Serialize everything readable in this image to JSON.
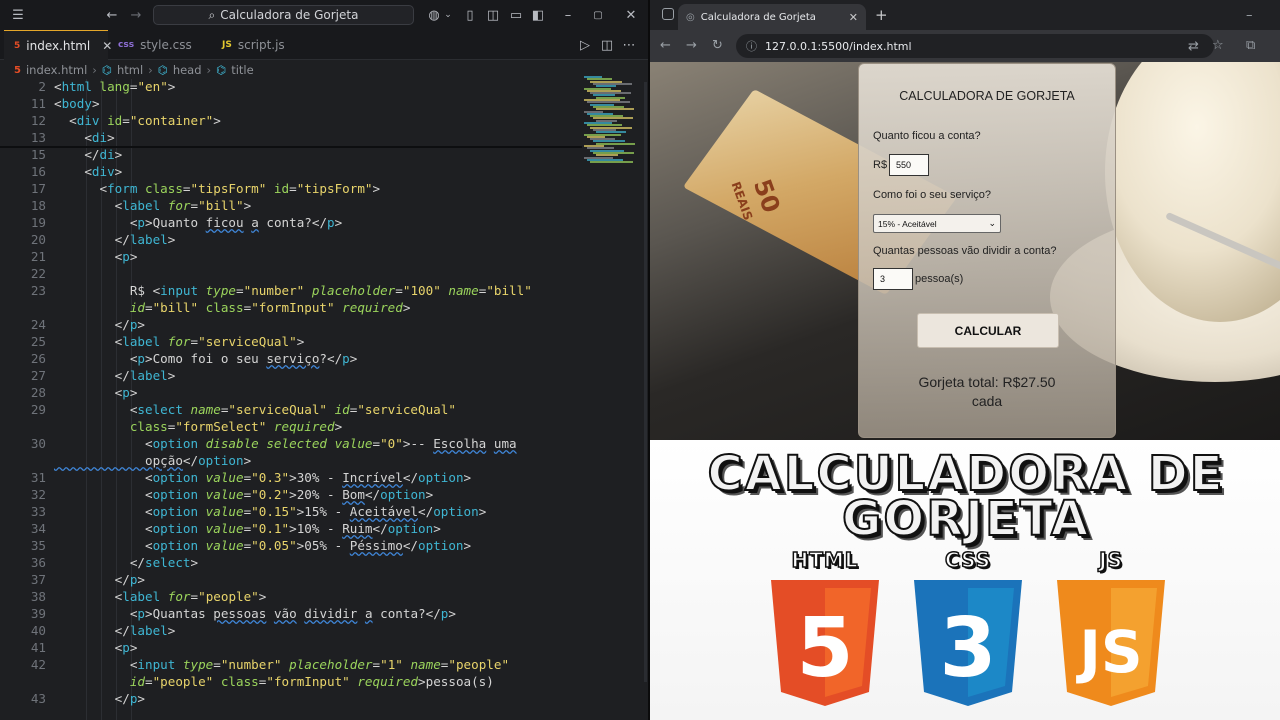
{
  "editor": {
    "search_title": "Calculadora de Gorjeta",
    "tabs": [
      {
        "badge": "5",
        "label": "index.html",
        "active": true
      },
      {
        "badge": "css",
        "label": "style.css",
        "active": false
      },
      {
        "badge": "JS",
        "label": "script.js",
        "active": false
      }
    ],
    "breadcrumb": [
      "index.html",
      "html",
      "head",
      "title"
    ],
    "code_lines": [
      {
        "n": "2",
        "t": [
          [
            "pu",
            "<"
          ],
          [
            "tg",
            "html"
          ],
          [
            "at",
            " lang"
          ],
          [
            "pu",
            "="
          ],
          [
            "st",
            "\"en\""
          ],
          [
            "pu",
            ">"
          ]
        ]
      },
      {
        "n": "11",
        "t": [
          [
            "pu",
            "<"
          ],
          [
            "tg",
            "body"
          ],
          [
            "pu",
            ">"
          ]
        ]
      },
      {
        "n": "12",
        "t": [
          [
            "pu",
            "  <"
          ],
          [
            "tg",
            "div"
          ],
          [
            "at",
            " id"
          ],
          [
            "pu",
            "="
          ],
          [
            "st",
            "\"container\""
          ],
          [
            "pu",
            ">"
          ]
        ]
      },
      {
        "n": "13",
        "t": [
          [
            "pu",
            "    <"
          ],
          [
            "tg",
            "di"
          ],
          [
            "pu",
            ">"
          ]
        ]
      },
      {
        "n": "15",
        "t": [
          [
            "pu",
            "    </"
          ],
          [
            "tg",
            "di"
          ],
          [
            "pu",
            ">"
          ]
        ]
      },
      {
        "n": "16",
        "t": [
          [
            "pu",
            "    <"
          ],
          [
            "tg",
            "div"
          ],
          [
            "pu",
            ">"
          ]
        ]
      },
      {
        "n": "17",
        "t": [
          [
            "pu",
            "      <"
          ],
          [
            "tg",
            "form"
          ],
          [
            "at",
            " class"
          ],
          [
            "pu",
            "="
          ],
          [
            "st",
            "\"tipsForm\""
          ],
          [
            "at",
            " id"
          ],
          [
            "pu",
            "="
          ],
          [
            "st",
            "\"tipsForm\""
          ],
          [
            "pu",
            ">"
          ]
        ]
      },
      {
        "n": "18",
        "t": [
          [
            "pu",
            "        <"
          ],
          [
            "tg",
            "label"
          ],
          [
            "ai",
            " for"
          ],
          [
            "pu",
            "="
          ],
          [
            "st",
            "\"bill\""
          ],
          [
            "pu",
            ">"
          ]
        ]
      },
      {
        "n": "19",
        "t": [
          [
            "pu",
            "          <"
          ],
          [
            "tg",
            "p"
          ],
          [
            "pu",
            ">"
          ],
          [
            "tx",
            "Quanto "
          ],
          [
            "sq",
            "ficou"
          ],
          [
            "tx",
            " "
          ],
          [
            "sq",
            "a"
          ],
          [
            "tx",
            " conta?"
          ],
          [
            "pu",
            "</"
          ],
          [
            "tg",
            "p"
          ],
          [
            "pu",
            ">"
          ]
        ]
      },
      {
        "n": "20",
        "t": [
          [
            "pu",
            "        </"
          ],
          [
            "tg",
            "label"
          ],
          [
            "pu",
            ">"
          ]
        ]
      },
      {
        "n": "21",
        "t": [
          [
            "pu",
            "        <"
          ],
          [
            "tg",
            "p"
          ],
          [
            "pu",
            ">"
          ]
        ]
      },
      {
        "n": "22",
        "t": []
      },
      {
        "n": "23",
        "t": [
          [
            "tx",
            "          R$ "
          ],
          [
            "pu",
            "<"
          ],
          [
            "tg",
            "input"
          ],
          [
            "ai",
            " type"
          ],
          [
            "pu",
            "="
          ],
          [
            "st",
            "\"number\""
          ],
          [
            "ai",
            " placeholder"
          ],
          [
            "pu",
            "="
          ],
          [
            "st",
            "\"100\""
          ],
          [
            "ai",
            " name"
          ],
          [
            "pu",
            "="
          ],
          [
            "st",
            "\"bill\""
          ]
        ]
      },
      {
        "n": "",
        "t": [
          [
            "ai",
            "          id"
          ],
          [
            "pu",
            "="
          ],
          [
            "st",
            "\"bill\""
          ],
          [
            "at",
            " class"
          ],
          [
            "pu",
            "="
          ],
          [
            "st",
            "\"formInput\""
          ],
          [
            "ai",
            " required"
          ],
          [
            "pu",
            ">"
          ]
        ]
      },
      {
        "n": "24",
        "t": [
          [
            "pu",
            "        </"
          ],
          [
            "tg",
            "p"
          ],
          [
            "pu",
            ">"
          ]
        ]
      },
      {
        "n": "25",
        "t": [
          [
            "pu",
            "        <"
          ],
          [
            "tg",
            "label"
          ],
          [
            "ai",
            " for"
          ],
          [
            "pu",
            "="
          ],
          [
            "st",
            "\"serviceQual\""
          ],
          [
            "pu",
            ">"
          ]
        ]
      },
      {
        "n": "26",
        "t": [
          [
            "pu",
            "          <"
          ],
          [
            "tg",
            "p"
          ],
          [
            "pu",
            ">"
          ],
          [
            "tx",
            "Como foi o seu "
          ],
          [
            "sq",
            "serviço"
          ],
          [
            "tx",
            "?"
          ],
          [
            "pu",
            "</"
          ],
          [
            "tg",
            "p"
          ],
          [
            "pu",
            ">"
          ]
        ]
      },
      {
        "n": "27",
        "t": [
          [
            "pu",
            "        </"
          ],
          [
            "tg",
            "label"
          ],
          [
            "pu",
            ">"
          ]
        ]
      },
      {
        "n": "28",
        "t": [
          [
            "pu",
            "        <"
          ],
          [
            "tg",
            "p"
          ],
          [
            "pu",
            ">"
          ]
        ]
      },
      {
        "n": "29",
        "t": [
          [
            "pu",
            "          <"
          ],
          [
            "tg",
            "select"
          ],
          [
            "ai",
            " name"
          ],
          [
            "pu",
            "="
          ],
          [
            "st",
            "\"serviceQual\""
          ],
          [
            "ai",
            " id"
          ],
          [
            "pu",
            "="
          ],
          [
            "st",
            "\"serviceQual\""
          ]
        ]
      },
      {
        "n": "",
        "t": [
          [
            "at",
            "          class"
          ],
          [
            "pu",
            "="
          ],
          [
            "st",
            "\"formSelect\""
          ],
          [
            "ai",
            " required"
          ],
          [
            "pu",
            ">"
          ]
        ]
      },
      {
        "n": "30",
        "t": [
          [
            "pu",
            "            <"
          ],
          [
            "tg",
            "option"
          ],
          [
            "ai",
            " disable"
          ],
          [
            "ai",
            " selected"
          ],
          [
            "ai",
            " value"
          ],
          [
            "pu",
            "="
          ],
          [
            "st",
            "\"0\""
          ],
          [
            "pu",
            ">"
          ],
          [
            "tx",
            "-- "
          ],
          [
            "sq",
            "Escolha"
          ],
          [
            "tx",
            " "
          ],
          [
            "sq",
            "uma"
          ]
        ]
      },
      {
        "n": "",
        "t": [
          [
            "sq",
            "            opção"
          ],
          [
            "pu",
            "</"
          ],
          [
            "tg",
            "option"
          ],
          [
            "pu",
            ">"
          ]
        ]
      },
      {
        "n": "31",
        "t": [
          [
            "pu",
            "            <"
          ],
          [
            "tg",
            "option"
          ],
          [
            "ai",
            " value"
          ],
          [
            "pu",
            "="
          ],
          [
            "st",
            "\"0.3\""
          ],
          [
            "pu",
            ">"
          ],
          [
            "tx",
            "30% - "
          ],
          [
            "sq",
            "Incrível"
          ],
          [
            "pu",
            "</"
          ],
          [
            "tg",
            "option"
          ],
          [
            "pu",
            ">"
          ]
        ]
      },
      {
        "n": "32",
        "t": [
          [
            "pu",
            "            <"
          ],
          [
            "tg",
            "option"
          ],
          [
            "ai",
            " value"
          ],
          [
            "pu",
            "="
          ],
          [
            "st",
            "\"0.2\""
          ],
          [
            "pu",
            ">"
          ],
          [
            "tx",
            "20% - "
          ],
          [
            "sq",
            "Bom"
          ],
          [
            "pu",
            "</"
          ],
          [
            "tg",
            "option"
          ],
          [
            "pu",
            ">"
          ]
        ]
      },
      {
        "n": "33",
        "t": [
          [
            "pu",
            "            <"
          ],
          [
            "tg",
            "option"
          ],
          [
            "ai",
            " value"
          ],
          [
            "pu",
            "="
          ],
          [
            "st",
            "\"0.15\""
          ],
          [
            "pu",
            ">"
          ],
          [
            "tx",
            "15% - "
          ],
          [
            "sq",
            "Aceitável"
          ],
          [
            "pu",
            "</"
          ],
          [
            "tg",
            "option"
          ],
          [
            "pu",
            ">"
          ]
        ]
      },
      {
        "n": "34",
        "t": [
          [
            "pu",
            "            <"
          ],
          [
            "tg",
            "option"
          ],
          [
            "ai",
            " value"
          ],
          [
            "pu",
            "="
          ],
          [
            "st",
            "\"0.1\""
          ],
          [
            "pu",
            ">"
          ],
          [
            "tx",
            "10% - "
          ],
          [
            "sq",
            "Ruim"
          ],
          [
            "pu",
            "</"
          ],
          [
            "tg",
            "option"
          ],
          [
            "pu",
            ">"
          ]
        ]
      },
      {
        "n": "35",
        "t": [
          [
            "pu",
            "            <"
          ],
          [
            "tg",
            "option"
          ],
          [
            "ai",
            " value"
          ],
          [
            "pu",
            "="
          ],
          [
            "st",
            "\"0.05\""
          ],
          [
            "pu",
            ">"
          ],
          [
            "tx",
            "05% - "
          ],
          [
            "sq",
            "Péssimo"
          ],
          [
            "pu",
            "</"
          ],
          [
            "tg",
            "option"
          ],
          [
            "pu",
            ">"
          ]
        ]
      },
      {
        "n": "36",
        "t": [
          [
            "pu",
            "          </"
          ],
          [
            "tg",
            "select"
          ],
          [
            "pu",
            ">"
          ]
        ]
      },
      {
        "n": "37",
        "t": [
          [
            "pu",
            "        </"
          ],
          [
            "tg",
            "p"
          ],
          [
            "pu",
            ">"
          ]
        ]
      },
      {
        "n": "38",
        "t": [
          [
            "pu",
            "        <"
          ],
          [
            "tg",
            "label"
          ],
          [
            "ai",
            " for"
          ],
          [
            "pu",
            "="
          ],
          [
            "st",
            "\"people\""
          ],
          [
            "pu",
            ">"
          ]
        ]
      },
      {
        "n": "39",
        "t": [
          [
            "pu",
            "          <"
          ],
          [
            "tg",
            "p"
          ],
          [
            "pu",
            ">"
          ],
          [
            "tx",
            "Quantas "
          ],
          [
            "sq",
            "pessoas"
          ],
          [
            "tx",
            " "
          ],
          [
            "sq",
            "vão"
          ],
          [
            "tx",
            " "
          ],
          [
            "sq",
            "dividir"
          ],
          [
            "tx",
            " "
          ],
          [
            "sq",
            "a"
          ],
          [
            "tx",
            " conta?"
          ],
          [
            "pu",
            "</"
          ],
          [
            "tg",
            "p"
          ],
          [
            "pu",
            ">"
          ]
        ]
      },
      {
        "n": "40",
        "t": [
          [
            "pu",
            "        </"
          ],
          [
            "tg",
            "label"
          ],
          [
            "pu",
            ">"
          ]
        ]
      },
      {
        "n": "41",
        "t": [
          [
            "pu",
            "        <"
          ],
          [
            "tg",
            "p"
          ],
          [
            "pu",
            ">"
          ]
        ]
      },
      {
        "n": "42",
        "t": [
          [
            "pu",
            "          <"
          ],
          [
            "tg",
            "input"
          ],
          [
            "ai",
            " type"
          ],
          [
            "pu",
            "="
          ],
          [
            "st",
            "\"number\""
          ],
          [
            "ai",
            " placeholder"
          ],
          [
            "pu",
            "="
          ],
          [
            "st",
            "\"1\""
          ],
          [
            "ai",
            " name"
          ],
          [
            "pu",
            "="
          ],
          [
            "st",
            "\"people\""
          ]
        ]
      },
      {
        "n": "",
        "t": [
          [
            "ai",
            "          id"
          ],
          [
            "pu",
            "="
          ],
          [
            "st",
            "\"people\""
          ],
          [
            "at",
            " class"
          ],
          [
            "pu",
            "="
          ],
          [
            "st",
            "\"formInput\""
          ],
          [
            "ai",
            " required"
          ],
          [
            "pu",
            ">"
          ],
          [
            "tx",
            "pessoa(s)"
          ]
        ]
      },
      {
        "n": "43",
        "t": [
          [
            "pu",
            "        </"
          ],
          [
            "tg",
            "p"
          ],
          [
            "pu",
            ">"
          ]
        ]
      }
    ]
  },
  "browser": {
    "tab_title": "Calculadora de Gorjeta",
    "url": "127.0.0.1:5500/index.html"
  },
  "calculator": {
    "title": "CALCULADORA DE GORJETA",
    "q_bill": "Quanto ficou a conta?",
    "currency": "R$",
    "bill_value": "550",
    "q_service": "Como foi o seu serviço?",
    "service_selected": "15% - Aceitável",
    "q_people": "Quantas pessoas vão dividir a conta?",
    "people_value": "3",
    "people_unit": "pessoa(s)",
    "button": "CALCULAR",
    "result_line1": "Gorjeta total: R$27.50",
    "result_line2": "cada"
  },
  "banknote": {
    "number": "50",
    "word": "REAIS"
  },
  "thumbnail": {
    "title_line1": "CALCULADORA DE",
    "title_line2": "GORJETA",
    "logos": [
      {
        "label": "HTML",
        "digit": "5",
        "color": "#e44d26",
        "color2": "#f16529"
      },
      {
        "label": "CSS",
        "digit": "3",
        "color": "#1b73ba",
        "color2": "#1c88c7"
      },
      {
        "label": "JS",
        "digit": "JS",
        "color": "#ef8a1c",
        "color2": "#f4a12f"
      }
    ]
  }
}
